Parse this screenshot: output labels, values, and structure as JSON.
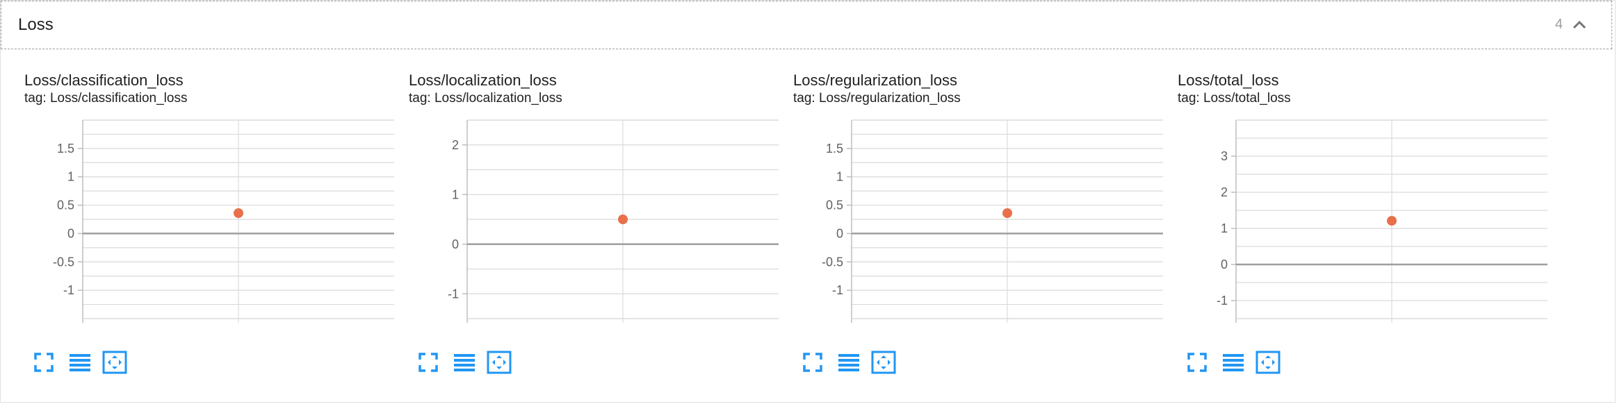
{
  "header": {
    "title": "Loss",
    "count": "4"
  },
  "icons": {
    "collapse": "chevron-up-icon",
    "fullscreen": "fullscreen-icon",
    "data_series": "list-lines-icon",
    "fit_domain": "fit-to-data-icon"
  },
  "colors": {
    "accent": "#2196f3",
    "point": "#e8704a",
    "grid": "#dadada",
    "zero_line": "#9e9e9e"
  },
  "cards": [
    {
      "title": "Loss/classification_loss",
      "tag": "tag: Loss/classification_loss",
      "chart_data": {
        "type": "scatter",
        "ylim": [
          -1.5,
          2.0
        ],
        "ytick_values": [
          -1,
          -0.5,
          0,
          0.5,
          1,
          1.5
        ],
        "yticks": [
          "-1",
          "-0.5",
          "0",
          "0.5",
          "1",
          "1.5"
        ],
        "points": [
          {
            "x": 0.5,
            "y": 0.36
          }
        ]
      }
    },
    {
      "title": "Loss/localization_loss",
      "tag": "tag: Loss/localization_loss",
      "chart_data": {
        "type": "scatter",
        "ylim": [
          -1.5,
          2.5
        ],
        "ytick_values": [
          -1,
          0,
          1,
          2
        ],
        "yticks": [
          "-1",
          "0",
          "1",
          "2"
        ],
        "points": [
          {
            "x": 0.5,
            "y": 0.5
          }
        ]
      }
    },
    {
      "title": "Loss/regularization_loss",
      "tag": "tag: Loss/regularization_loss",
      "chart_data": {
        "type": "scatter",
        "ylim": [
          -1.5,
          2.0
        ],
        "ytick_values": [
          -1,
          -0.5,
          0,
          0.5,
          1,
          1.5
        ],
        "yticks": [
          "-1",
          "-0.5",
          "0",
          "0.5",
          "1",
          "1.5"
        ],
        "points": [
          {
            "x": 0.5,
            "y": 0.36
          }
        ]
      }
    },
    {
      "title": "Loss/total_loss",
      "tag": "tag: Loss/total_loss",
      "chart_data": {
        "type": "scatter",
        "ylim": [
          -1.5,
          4.0
        ],
        "ytick_values": [
          -1,
          0,
          1,
          2,
          3
        ],
        "yticks": [
          "-1",
          "0",
          "1",
          "2",
          "3"
        ],
        "points": [
          {
            "x": 0.5,
            "y": 1.21
          }
        ]
      }
    }
  ]
}
